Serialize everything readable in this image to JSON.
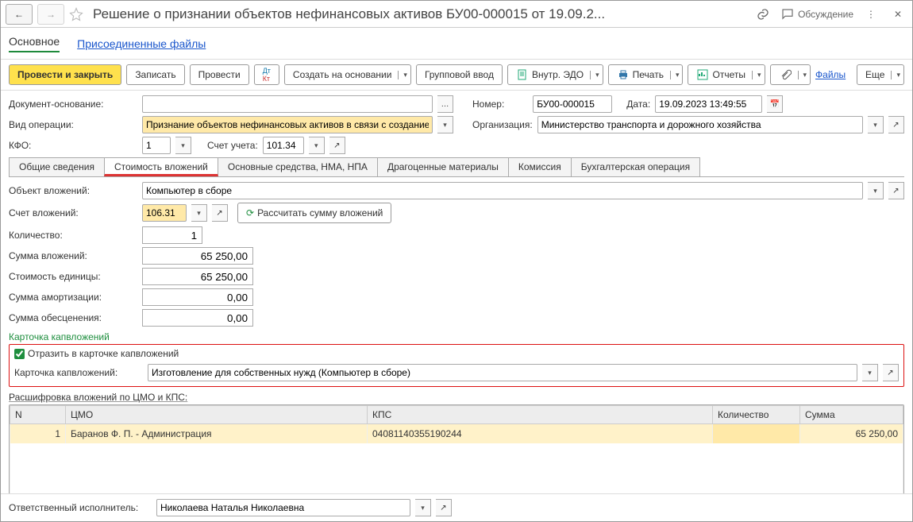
{
  "title": "Решение о признании объектов нефинансовых активов БУ00-000015 от 19.09.2...",
  "discuss_label": "Обсуждение",
  "sections": {
    "main": "Основное",
    "files": "Присоединенные файлы"
  },
  "toolbar": {
    "post_close": "Провести и закрыть",
    "save": "Записать",
    "post": "Провести",
    "create_basis": "Создать на основании",
    "group_input": "Групповой ввод",
    "internal_edo": "Внутр. ЭДО",
    "print": "Печать",
    "reports": "Отчеты",
    "files": "Файлы",
    "more": "Еще"
  },
  "h": {
    "doc_basis_lbl": "Документ-основание:",
    "doc_basis": "",
    "num_lbl": "Номер:",
    "num": "БУ00-000015",
    "date_lbl": "Дата:",
    "date": "19.09.2023 13:49:55",
    "op_lbl": "Вид операции:",
    "op": "Признание объектов нефинансовых активов в связи с созданием",
    "org_lbl": "Организация:",
    "org": "Министерство транспорта и дорожного хозяйства",
    "kfo_lbl": "КФО:",
    "kfo": "1",
    "acct_lbl": "Счет учета:",
    "acct": "101.34"
  },
  "tabs": {
    "t1": "Общие сведения",
    "t2": "Стоимость вложений",
    "t3": "Основные средства, НМА, НПА",
    "t4": "Драгоценные материалы",
    "t5": "Комиссия",
    "t6": "Бухгалтерская операция"
  },
  "inv": {
    "obj_lbl": "Объект вложений:",
    "obj": "Компьютер в сборе",
    "acct_lbl": "Счет вложений:",
    "acct": "106.31",
    "recalc_label": "Рассчитать сумму вложений",
    "qty_lbl": "Количество:",
    "qty": "1",
    "sum_lbl": "Сумма вложений:",
    "sum": "65 250,00",
    "unit_lbl": "Стоимость единицы:",
    "unit": "65 250,00",
    "amort_lbl": "Сумма амортизации:",
    "amort": "0,00",
    "depr_lbl": "Сумма обесценения:",
    "depr": "0,00"
  },
  "card": {
    "title": "Карточка капвложений",
    "chk_label": "Отразить в карточке капвложений",
    "field_lbl": "Карточка капвложений:",
    "field_val": "Изготовление для собственных нужд (Компьютер в сборе)"
  },
  "grid": {
    "title": "Расшифровка вложений по ЦМО и КПС:",
    "cols": {
      "n": "N",
      "cmo": "ЦМО",
      "kps": "КПС",
      "qty": "Количество",
      "sum": "Сумма"
    },
    "rows": [
      {
        "n": "1",
        "cmo": "Баранов Ф. П. - Администрация",
        "kps": "04081140355190244",
        "qty": "",
        "sum": "65 250,00"
      }
    ]
  },
  "footer": {
    "lbl": "Ответственный исполнитель:",
    "val": "Николаева Наталья Николаевна"
  }
}
